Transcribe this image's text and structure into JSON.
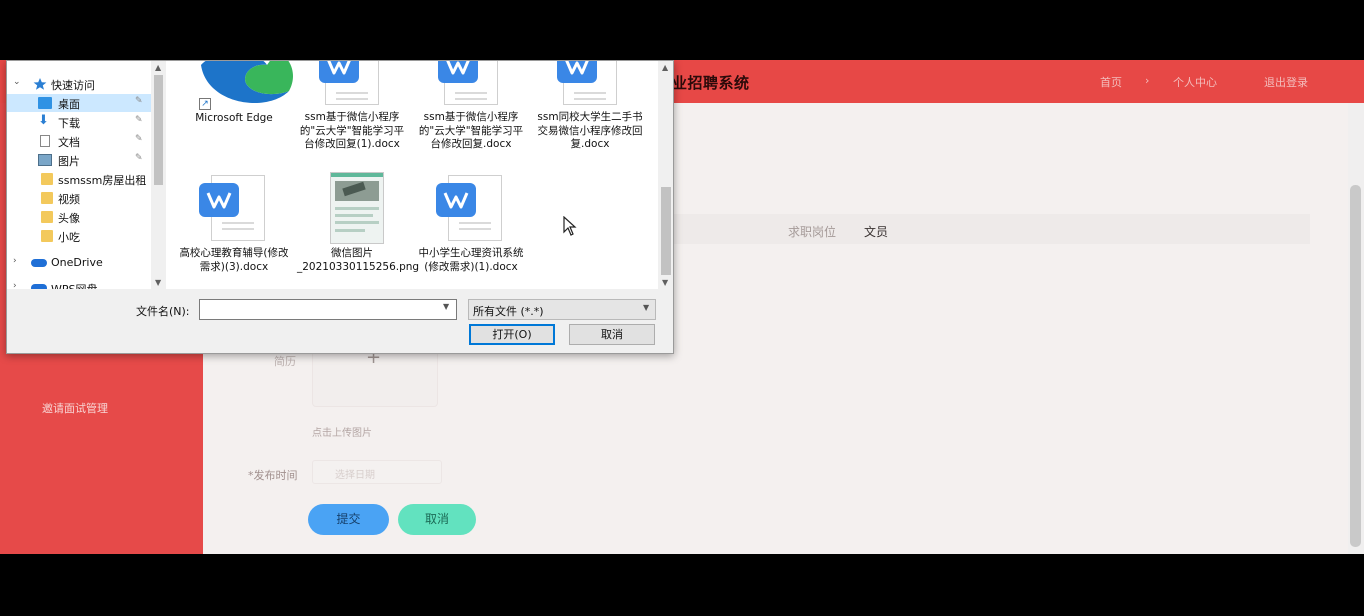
{
  "app": {
    "title": "业招聘系统",
    "header_links": [
      "首页",
      "个人中心",
      "退出登录"
    ],
    "sidebar_menu": "邀请面试管理",
    "form": {
      "job_label": "求职岗位",
      "job_value": "文员",
      "upload_label": "简历",
      "upload_plus": "+",
      "upload_hint": "点击上传图片",
      "date_label": "*发布时间",
      "date_placeholder": "选择日期",
      "submit_label": "提交",
      "cancel_label": "取消"
    }
  },
  "dialog": {
    "nav_items": [
      {
        "label": "快速访问",
        "icon": "star-icon"
      },
      {
        "label": "桌面",
        "icon": "desktop-icon",
        "selected": true,
        "pinned": true
      },
      {
        "label": "下载",
        "icon": "download-icon",
        "pinned": true
      },
      {
        "label": "文档",
        "icon": "document-icon",
        "pinned": true
      },
      {
        "label": "图片",
        "icon": "picture-icon",
        "pinned": true
      },
      {
        "label": "ssmssm房屋出租",
        "icon": "folder-icon"
      },
      {
        "label": "视频",
        "icon": "folder-icon"
      },
      {
        "label": "头像",
        "icon": "folder-icon"
      },
      {
        "label": "小吃",
        "icon": "folder-icon"
      },
      {
        "label": "OneDrive",
        "icon": "cloud-icon"
      },
      {
        "label": "WPS网盘",
        "icon": "cloud-icon"
      }
    ],
    "files": [
      {
        "name": "Microsoft Edge",
        "type": "edge-shortcut"
      },
      {
        "name": "ssm基于微信小程序的\"云大学\"智能学习平台修改回复(1).docx",
        "type": "wps-doc"
      },
      {
        "name": "ssm基于微信小程序的\"云大学\"智能学习平台修改回复.docx",
        "type": "wps-doc"
      },
      {
        "name": "ssm同校大学生二手书交易微信小程序修改回复.docx",
        "type": "wps-doc"
      },
      {
        "name": "高校心理教育辅导(修改需求)(3).docx",
        "type": "wps-doc"
      },
      {
        "name": "微信图片_20210330115256.png",
        "type": "image"
      },
      {
        "name": "中小学生心理资讯系统(修改需求)(1).docx",
        "type": "wps-doc"
      }
    ],
    "filename_label": "文件名(N):",
    "filename_value": "",
    "filter_value": "所有文件 (*.*)",
    "open_label": "打开(O)",
    "cancel_label": "取消"
  },
  "colors": {
    "header_red": "#e74846",
    "sidebar_red": "#e64a49",
    "submit_blue": "#4aa3f4",
    "cancel_green": "#62e2bf",
    "wps_blue": "#3a87e6",
    "selection": "#cce8ff"
  }
}
